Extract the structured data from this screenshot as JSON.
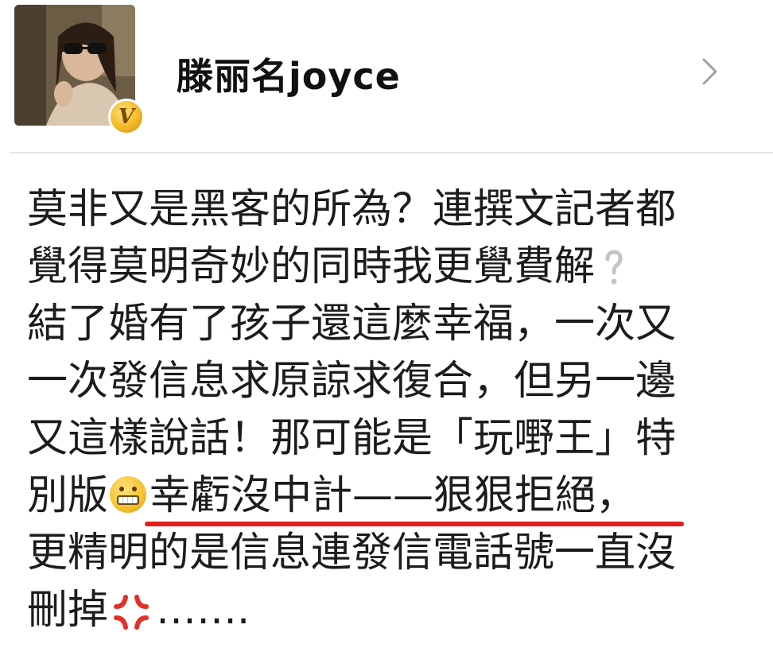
{
  "profile": {
    "username": "滕丽名joyce",
    "verified_badge": "V"
  },
  "post": {
    "line1": "莫非又是黑客的所為？連撰文記者都",
    "line2": "覺得莫明奇妙的同時我更覺費解",
    "line3": "結了婚有了孩子還這麼幸福，一次又",
    "line4": "一次發信息求原諒求復合，但另一邊",
    "line5": "又這樣說話！那可能是「玩嘢王」特",
    "line6_prefix": "別版",
    "line6_underlined": "幸虧沒中計——狠狠拒絕，",
    "line7": "更精明的是信息連發信電話號一直沒",
    "line8_prefix": "刪掉",
    "line8_suffix": "……."
  },
  "icons": {
    "chevron": "chevron-right-icon",
    "grin_emoji": "grinning-emoji-icon",
    "angry_emoji": "angry-symbol-icon",
    "question_emoji": "question-mark-icon"
  },
  "colors": {
    "underline": "#e1201c",
    "badge": "#f2b927",
    "text": "#1c1c1c"
  }
}
